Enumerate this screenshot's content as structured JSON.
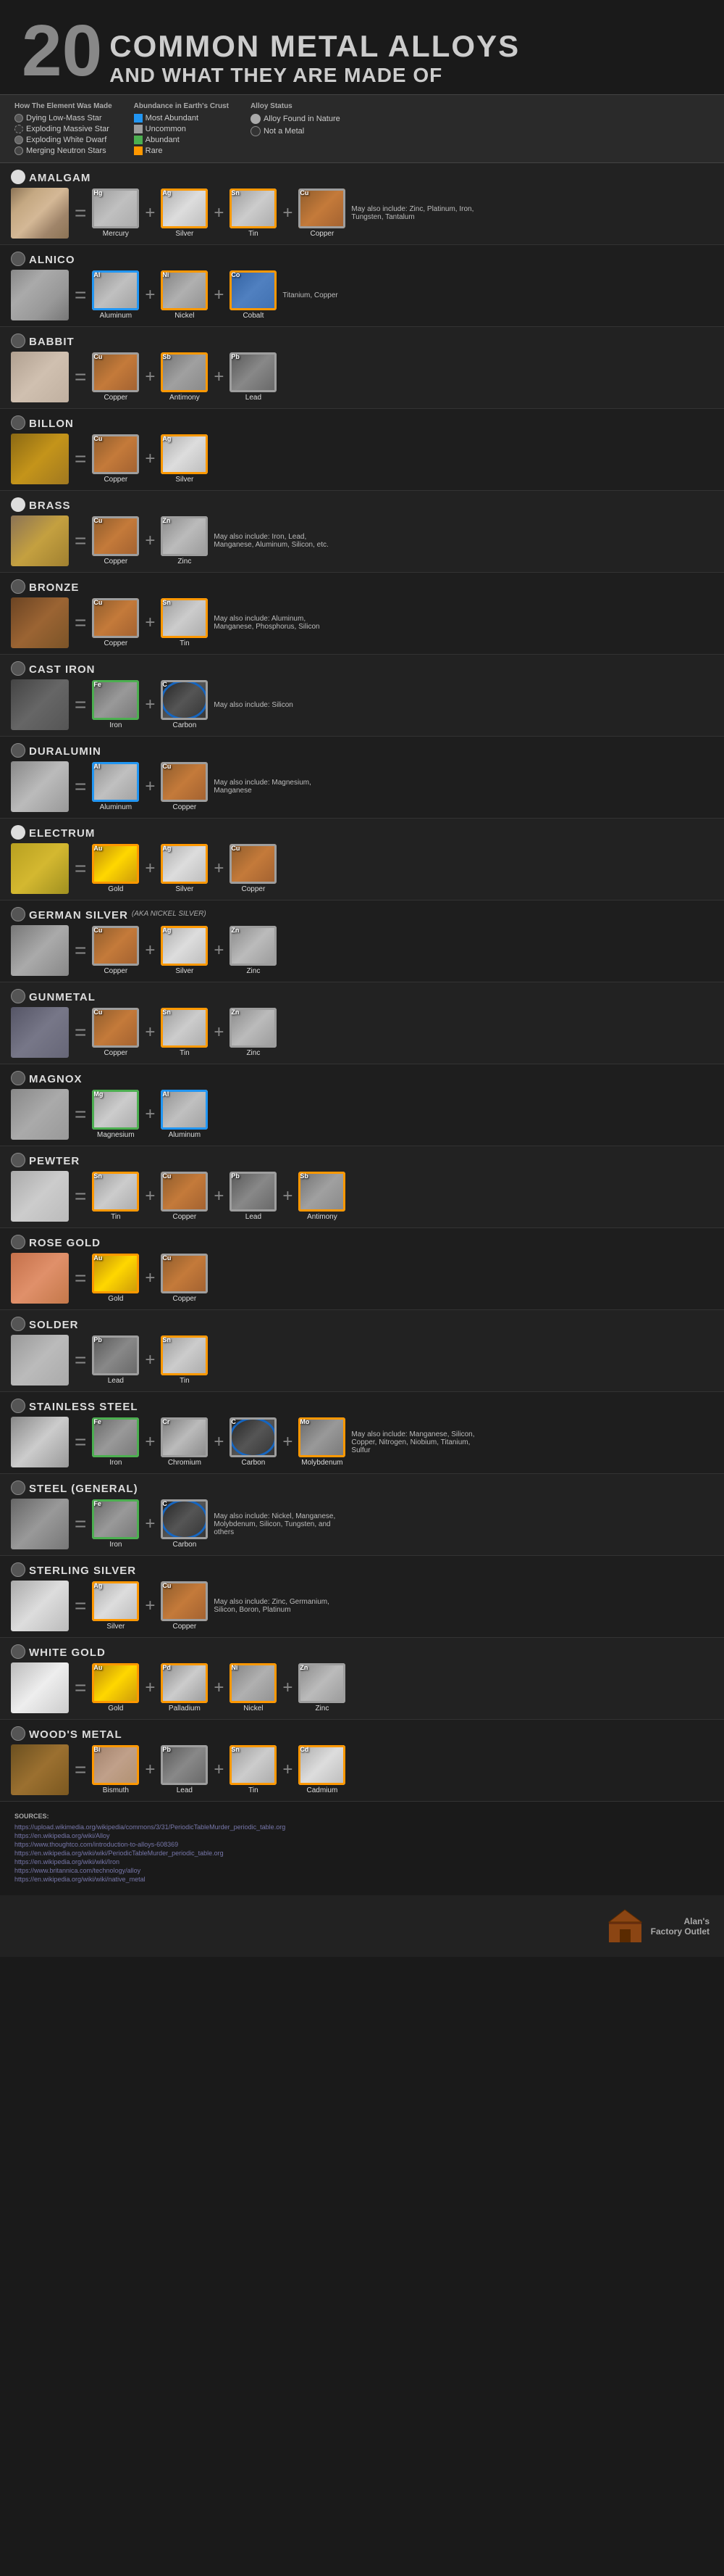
{
  "header": {
    "number": "20",
    "line1": "Common Metal Alloys",
    "line2": "And What They Are Made Of"
  },
  "legend": {
    "how_made_title": "How The Element Was Made",
    "items_made": [
      {
        "label": "Dying Low-Mass Star",
        "type": "dying"
      },
      {
        "label": "Exploding Massive Star",
        "type": "exploding-massive"
      },
      {
        "label": "Exploding White Dwarf",
        "type": "exploding-dwarf"
      },
      {
        "label": "Merging Neutron Stars",
        "type": "merging"
      }
    ],
    "abundance_title": "Abundance in Earth's Crust",
    "items_abundance": [
      {
        "label": "Most Abundant",
        "type": "most-abundant"
      },
      {
        "label": "Uncommon",
        "type": "uncommon"
      },
      {
        "label": "Abundant",
        "type": "abundant"
      },
      {
        "label": "Rare",
        "type": "rare"
      }
    ],
    "alloy_found_label": "Alloy Found in Nature",
    "not_metal_label": "Not a Metal"
  },
  "alloys": [
    {
      "name": "AMALGAM",
      "subtitle": "",
      "texture": "texture-amalgam",
      "found": true,
      "elements": [
        {
          "symbol": "Hg",
          "name": "Mercury",
          "texture": "tex-mercury",
          "abundance": "uncommon",
          "origin": "dying"
        },
        {
          "symbol": "Ag",
          "name": "Silver",
          "texture": "tex-silver",
          "abundance": "rare",
          "origin": "merging"
        },
        {
          "symbol": "Sn",
          "name": "Tin",
          "texture": "tex-tin",
          "abundance": "rare",
          "origin": "dying"
        },
        {
          "symbol": "Cu",
          "name": "Copper",
          "texture": "tex-copper",
          "abundance": "uncommon",
          "origin": "dying"
        }
      ],
      "may_also": "May also include: Zinc, Platinum, Iron, Tungsten, Tantalum"
    },
    {
      "name": "ALNICO",
      "subtitle": "",
      "texture": "texture-alnico",
      "found": false,
      "elements": [
        {
          "symbol": "Al",
          "name": "Aluminum",
          "texture": "tex-aluminum",
          "abundance": "most-abundant",
          "origin": "exploding-massive"
        },
        {
          "symbol": "Ni",
          "name": "Nickel",
          "texture": "tex-nickel",
          "abundance": "rare",
          "origin": "dying"
        },
        {
          "symbol": "Co",
          "name": "Cobalt",
          "texture": "tex-cobalt",
          "abundance": "rare",
          "origin": "dying"
        }
      ],
      "may_also": "Titanium, Copper"
    },
    {
      "name": "BABBIT",
      "subtitle": "",
      "texture": "texture-babbit",
      "found": false,
      "elements": [
        {
          "symbol": "Cu",
          "name": "Copper",
          "texture": "tex-copper",
          "abundance": "uncommon",
          "origin": "dying"
        },
        {
          "symbol": "Sb",
          "name": "Antimony",
          "texture": "tex-antimony",
          "abundance": "rare",
          "origin": "dying"
        },
        {
          "symbol": "Pb",
          "name": "Lead",
          "texture": "tex-lead",
          "abundance": "uncommon",
          "origin": "dying"
        }
      ],
      "may_also": ""
    },
    {
      "name": "BILLON",
      "subtitle": "",
      "texture": "texture-billon",
      "found": false,
      "elements": [
        {
          "symbol": "Cu",
          "name": "Copper",
          "texture": "tex-copper",
          "abundance": "uncommon",
          "origin": "dying"
        },
        {
          "symbol": "Ag",
          "name": "Silver",
          "texture": "tex-silver",
          "abundance": "rare",
          "origin": "merging"
        }
      ],
      "may_also": ""
    },
    {
      "name": "BRASS",
      "subtitle": "",
      "texture": "texture-brass",
      "found": true,
      "elements": [
        {
          "symbol": "Cu",
          "name": "Copper",
          "texture": "tex-copper",
          "abundance": "uncommon",
          "origin": "dying"
        },
        {
          "symbol": "Zn",
          "name": "Zinc",
          "texture": "tex-zinc",
          "abundance": "uncommon",
          "origin": "dying"
        }
      ],
      "may_also": "May also include: Iron, Lead, Manganese, Aluminum, Silicon, etc."
    },
    {
      "name": "BRONZE",
      "subtitle": "",
      "texture": "texture-bronze",
      "found": false,
      "elements": [
        {
          "symbol": "Cu",
          "name": "Copper",
          "texture": "tex-copper",
          "abundance": "uncommon",
          "origin": "dying"
        },
        {
          "symbol": "Sn",
          "name": "Tin",
          "texture": "tex-tin",
          "abundance": "rare",
          "origin": "dying"
        }
      ],
      "may_also": "May also include: Aluminum, Manganese, Phosphorus, Silicon"
    },
    {
      "name": "CAST IRON",
      "subtitle": "",
      "texture": "texture-cast-iron",
      "found": false,
      "elements": [
        {
          "symbol": "Fe",
          "name": "Iron",
          "texture": "tex-iron",
          "abundance": "abundant",
          "origin": "exploding-massive"
        },
        {
          "symbol": "C",
          "name": "Carbon",
          "texture": "tex-carbon",
          "abundance": "uncommon",
          "origin": "dying",
          "not_metal": true
        }
      ],
      "may_also": "May also include: Silicon"
    },
    {
      "name": "DURALUMIN",
      "subtitle": "",
      "texture": "texture-duralumin",
      "found": false,
      "elements": [
        {
          "symbol": "Al",
          "name": "Aluminum",
          "texture": "tex-aluminum",
          "abundance": "most-abundant",
          "origin": "exploding-massive"
        },
        {
          "symbol": "Cu",
          "name": "Copper",
          "texture": "tex-copper",
          "abundance": "uncommon",
          "origin": "dying"
        }
      ],
      "may_also": "May also include: Magnesium, Manganese"
    },
    {
      "name": "ELECTRUM",
      "subtitle": "",
      "texture": "texture-electrum",
      "found": true,
      "elements": [
        {
          "symbol": "Au",
          "name": "Gold",
          "texture": "tex-gold",
          "abundance": "rare",
          "origin": "merging"
        },
        {
          "symbol": "Ag",
          "name": "Silver",
          "texture": "tex-silver",
          "abundance": "rare",
          "origin": "merging"
        },
        {
          "symbol": "Cu",
          "name": "Copper",
          "texture": "tex-copper",
          "abundance": "uncommon",
          "origin": "dying"
        }
      ],
      "may_also": ""
    },
    {
      "name": "GERMAN SILVER",
      "subtitle": "(AKA NICKEL SILVER)",
      "texture": "texture-german-silver",
      "found": false,
      "elements": [
        {
          "symbol": "Cu",
          "name": "Copper",
          "texture": "tex-copper",
          "abundance": "uncommon",
          "origin": "dying"
        },
        {
          "symbol": "Ag",
          "name": "Silver",
          "texture": "tex-silver",
          "abundance": "rare",
          "origin": "merging"
        },
        {
          "symbol": "Zn",
          "name": "Zinc",
          "texture": "tex-zinc",
          "abundance": "uncommon",
          "origin": "dying"
        }
      ],
      "may_also": ""
    },
    {
      "name": "GUNMETAL",
      "subtitle": "",
      "texture": "texture-gunmetal",
      "found": false,
      "elements": [
        {
          "symbol": "Cu",
          "name": "Copper",
          "texture": "tex-copper",
          "abundance": "uncommon",
          "origin": "dying"
        },
        {
          "symbol": "Sn",
          "name": "Tin",
          "texture": "tex-tin",
          "abundance": "rare",
          "origin": "dying"
        },
        {
          "symbol": "Zn",
          "name": "Zinc",
          "texture": "tex-zinc",
          "abundance": "uncommon",
          "origin": "dying"
        }
      ],
      "may_also": ""
    },
    {
      "name": "MAGNOX",
      "subtitle": "",
      "texture": "texture-magnox",
      "found": false,
      "elements": [
        {
          "symbol": "Mg",
          "name": "Magnesium",
          "texture": "tex-magnesium",
          "abundance": "abundant",
          "origin": "dying"
        },
        {
          "symbol": "Al",
          "name": "Aluminum",
          "texture": "tex-aluminum",
          "abundance": "most-abundant",
          "origin": "exploding-massive"
        }
      ],
      "may_also": ""
    },
    {
      "name": "PEWTER",
      "subtitle": "",
      "texture": "texture-pewter",
      "found": false,
      "elements": [
        {
          "symbol": "Sn",
          "name": "Tin",
          "texture": "tex-tin",
          "abundance": "rare",
          "origin": "dying"
        },
        {
          "symbol": "Cu",
          "name": "Copper",
          "texture": "tex-copper",
          "abundance": "uncommon",
          "origin": "dying"
        },
        {
          "symbol": "Pb",
          "name": "Lead",
          "texture": "tex-lead",
          "abundance": "uncommon",
          "origin": "dying"
        },
        {
          "symbol": "Sb",
          "name": "Antimony",
          "texture": "tex-antimony",
          "abundance": "rare",
          "origin": "dying"
        }
      ],
      "may_also": ""
    },
    {
      "name": "ROSE GOLD",
      "subtitle": "",
      "texture": "texture-rose-gold",
      "found": false,
      "elements": [
        {
          "symbol": "Au",
          "name": "Gold",
          "texture": "tex-gold",
          "abundance": "rare",
          "origin": "merging"
        },
        {
          "symbol": "Cu",
          "name": "Copper",
          "texture": "tex-copper",
          "abundance": "uncommon",
          "origin": "dying"
        }
      ],
      "may_also": ""
    },
    {
      "name": "SOLDER",
      "subtitle": "",
      "texture": "texture-solder",
      "found": false,
      "elements": [
        {
          "symbol": "Pb",
          "name": "Lead",
          "texture": "tex-lead",
          "abundance": "uncommon",
          "origin": "dying"
        },
        {
          "symbol": "Sn",
          "name": "Tin",
          "texture": "tex-tin",
          "abundance": "rare",
          "origin": "dying"
        }
      ],
      "may_also": ""
    },
    {
      "name": "STAINLESS STEEL",
      "subtitle": "",
      "texture": "texture-stainless",
      "found": false,
      "elements": [
        {
          "symbol": "Fe",
          "name": "Iron",
          "texture": "tex-iron",
          "abundance": "abundant",
          "origin": "exploding-massive"
        },
        {
          "symbol": "Cr",
          "name": "Chromium",
          "texture": "tex-chromium",
          "abundance": "uncommon",
          "origin": "dying"
        },
        {
          "symbol": "C",
          "name": "Carbon",
          "texture": "tex-carbon",
          "abundance": "uncommon",
          "origin": "dying",
          "not_metal": true
        },
        {
          "symbol": "Mo",
          "name": "Molybdenum",
          "texture": "tex-molybdenum",
          "abundance": "rare",
          "origin": "dying"
        }
      ],
      "may_also": "May also include: Manganese, Silicon, Copper, Nitrogen, Niobium, Titanium, Sulfur"
    },
    {
      "name": "STEEL (GENERAL)",
      "subtitle": "",
      "texture": "texture-steel",
      "found": false,
      "elements": [
        {
          "symbol": "Fe",
          "name": "Iron",
          "texture": "tex-iron",
          "abundance": "abundant",
          "origin": "exploding-massive"
        },
        {
          "symbol": "C",
          "name": "Carbon",
          "texture": "tex-carbon",
          "abundance": "uncommon",
          "origin": "dying",
          "not_metal": true
        }
      ],
      "may_also": "May also include: Nickel, Manganese, Molybdenum, Silicon, Tungsten, and others"
    },
    {
      "name": "STERLING SILVER",
      "subtitle": "",
      "texture": "texture-sterling",
      "found": false,
      "elements": [
        {
          "symbol": "Ag",
          "name": "Silver",
          "texture": "tex-silver",
          "abundance": "rare",
          "origin": "merging"
        },
        {
          "symbol": "Cu",
          "name": "Copper",
          "texture": "tex-copper",
          "abundance": "uncommon",
          "origin": "dying"
        }
      ],
      "may_also": "May also include: Zinc, Germanium, Silicon, Boron, Platinum"
    },
    {
      "name": "WHITE GOLD",
      "subtitle": "",
      "texture": "texture-white-gold",
      "found": false,
      "elements": [
        {
          "symbol": "Au",
          "name": "Gold",
          "texture": "tex-gold",
          "abundance": "rare",
          "origin": "merging"
        },
        {
          "symbol": "Pd",
          "name": "Palladium",
          "texture": "tex-palladium",
          "abundance": "rare",
          "origin": "dying"
        },
        {
          "symbol": "Ni",
          "name": "Nickel",
          "texture": "tex-nickel",
          "abundance": "rare",
          "origin": "dying"
        },
        {
          "symbol": "Zn",
          "name": "Zinc",
          "texture": "tex-zinc",
          "abundance": "uncommon",
          "origin": "dying"
        }
      ],
      "may_also": ""
    },
    {
      "name": "WOOD'S METAL",
      "subtitle": "",
      "texture": "texture-woods",
      "found": false,
      "elements": [
        {
          "symbol": "Bi",
          "name": "Bismuth",
          "texture": "tex-bismuth",
          "abundance": "rare",
          "origin": "dying"
        },
        {
          "symbol": "Pb",
          "name": "Lead",
          "texture": "tex-lead",
          "abundance": "uncommon",
          "origin": "dying"
        },
        {
          "symbol": "Sn",
          "name": "Tin",
          "texture": "tex-tin",
          "abundance": "rare",
          "origin": "dying"
        },
        {
          "symbol": "Cd",
          "name": "Cadmium",
          "texture": "tex-cadmium",
          "abundance": "rare",
          "origin": "dying"
        }
      ],
      "may_also": ""
    }
  ],
  "sources": {
    "title": "SOURCES:",
    "links": [
      "https://upload.wikimedia.org/wikipedia/commons/3/31/PeriodicTableMurder_periodic_table.org",
      "https://en.wikipedia.org/wiki/Alloy",
      "https://www.thoughtco.com/introduction-to-alloys-608369",
      "https://en.wikipedia.org/wiki/wiki/PeriodicTableMurder_periodic_table.org",
      "https://en.wikipedia.org/wiki/wiki/Iron",
      "https://www.britannica.com/technology/alloy",
      "https://en.wikipedia.org/wiki/wiki/native_metal"
    ]
  },
  "footer": {
    "brand": "Alan's",
    "brand_sub": "Factory Outlet"
  },
  "right_legend": {
    "found": "Alloy Found in Nature",
    "not_metal": "Not a Metal"
  }
}
